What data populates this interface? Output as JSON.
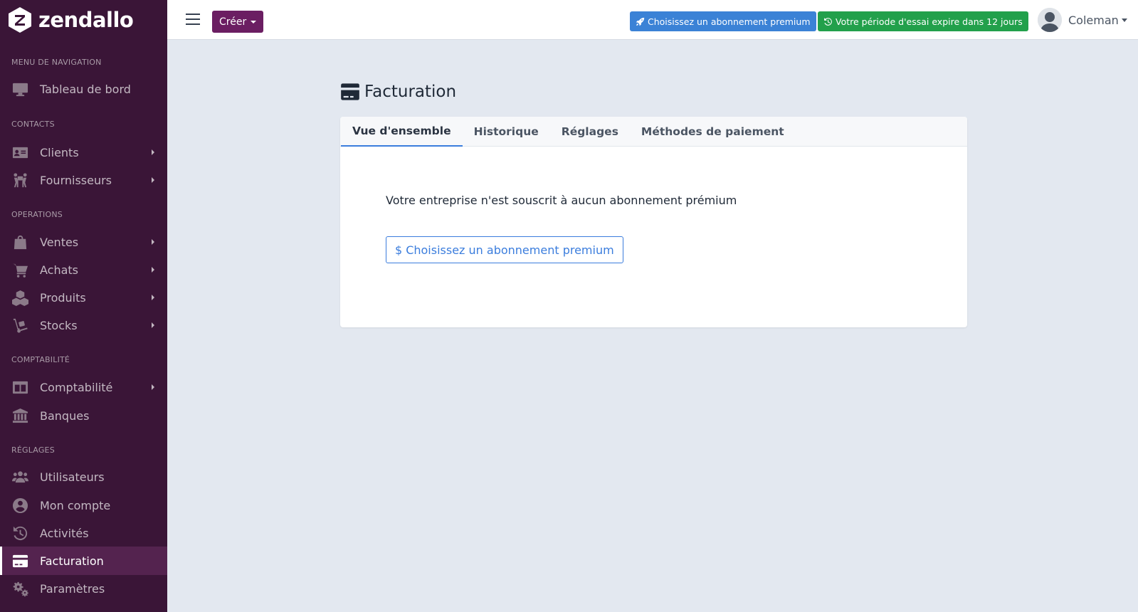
{
  "brand": {
    "name": "zendallo"
  },
  "sidebar": {
    "sections": [
      {
        "title": "MENU DE NAVIGATION"
      },
      {
        "title": "CONTACTS"
      },
      {
        "title": "OPERATIONS"
      },
      {
        "title": "COMPTABILITÉ"
      },
      {
        "title": "RÉGLAGES"
      }
    ],
    "items": [
      {
        "label": "Tableau de bord",
        "icon": "desktop-icon"
      },
      {
        "label": "Clients",
        "icon": "id-card-icon",
        "has_submenu": true
      },
      {
        "label": "Fournisseurs",
        "icon": "people-carry-icon",
        "has_submenu": true
      },
      {
        "label": "Ventes",
        "icon": "shopping-bag-icon",
        "has_submenu": true
      },
      {
        "label": "Achats",
        "icon": "cart-icon",
        "has_submenu": true
      },
      {
        "label": "Produits",
        "icon": "cubes-icon",
        "has_submenu": true
      },
      {
        "label": "Stocks",
        "icon": "dolly-icon",
        "has_submenu": true
      },
      {
        "label": "Comptabilité",
        "icon": "columns-icon",
        "has_submenu": true
      },
      {
        "label": "Banques",
        "icon": "bank-icon"
      },
      {
        "label": "Utilisateurs",
        "icon": "users-icon"
      },
      {
        "label": "Mon compte",
        "icon": "user-circle-icon"
      },
      {
        "label": "Activités",
        "icon": "history-icon"
      },
      {
        "label": "Facturation",
        "icon": "credit-card-icon",
        "active": true
      },
      {
        "label": "Paramètres",
        "icon": "cogs-icon"
      }
    ]
  },
  "topbar": {
    "create_label": "Créer",
    "premium_label": "Choisissez un abonnement premium",
    "trial_label": "Votre période d'essai expire dans 12 jours",
    "user_name": "Coleman"
  },
  "main": {
    "title": "Facturation",
    "tabs": [
      {
        "label": "Vue d'ensemble",
        "active": true
      },
      {
        "label": "Historique"
      },
      {
        "label": "Réglages"
      },
      {
        "label": "Méthodes de paiement"
      }
    ],
    "message": "Votre entreprise n'est souscrit à aucun abonnement prémium",
    "cta_label": "Choisissez un abonnement premium",
    "cta_symbol": "$"
  },
  "colors": {
    "sidebar_bg": "#3a1537",
    "create_btn": "#6b1e62",
    "premium_btn": "#3b82d6",
    "trial_btn": "#22a04b",
    "accent": "#3b7ddd",
    "content_bg": "#e3e8f0"
  }
}
